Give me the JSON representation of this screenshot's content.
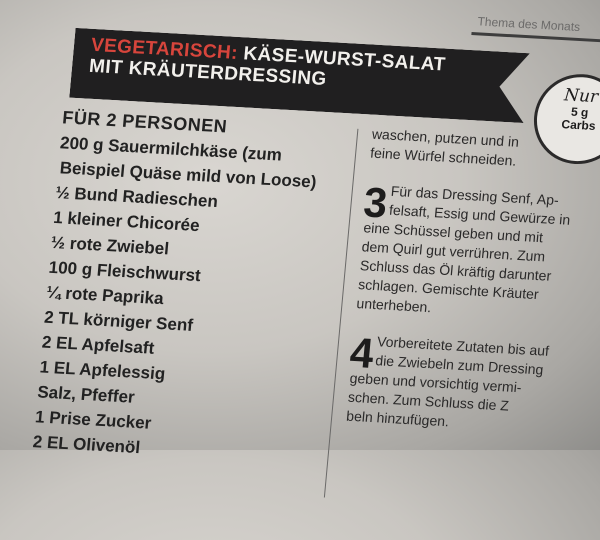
{
  "header": {
    "tag": "Thema des Monats"
  },
  "banner": {
    "highlight": "VEGETARISCH:",
    "line1_rest": " KÄSE-WURST-SALAT",
    "line2": "MIT KRÄUTERDRESSING"
  },
  "badge": {
    "nur": "Nur",
    "line1": "5 g",
    "line2": "Carbs"
  },
  "ingredients": {
    "title": "FÜR 2 PERSONEN",
    "items": [
      "200 g Sauermilchkäse (zum",
      "Beispiel Quäse mild von Loose)",
      "½ Bund Radieschen",
      "1 kleiner Chicorée",
      "½ rote Zwiebel",
      "100 g Fleischwurst",
      "¼ rote Paprika",
      "2 TL körniger Senf",
      "2 EL Apfelsaft",
      "1 EL Apfelessig",
      "Salz, Pfeffer",
      "1 Prise Zucker",
      "2 EL Olivenöl"
    ]
  },
  "instructions": {
    "continued_line1": "waschen, putzen und in",
    "continued_line2": "feine Würfel schneiden.",
    "step3": {
      "num": "3",
      "lines": [
        "Für das Dressing Senf, Ap-",
        "felsaft, Essig und Gewürze in",
        "eine Schüssel geben und mit",
        "dem Quirl gut verrühren. Zum",
        "Schluss das Öl kräftig darunter",
        "schlagen. Gemischte Kräuter",
        "unterheben."
      ]
    },
    "step4": {
      "num": "4",
      "lines": [
        "Vorbereitete Zutaten bis auf",
        "die Zwiebeln zum Dressing",
        "geben und vorsichtig vermi-",
        "schen. Zum Schluss die Z",
        "beln hinzufügen."
      ]
    }
  }
}
